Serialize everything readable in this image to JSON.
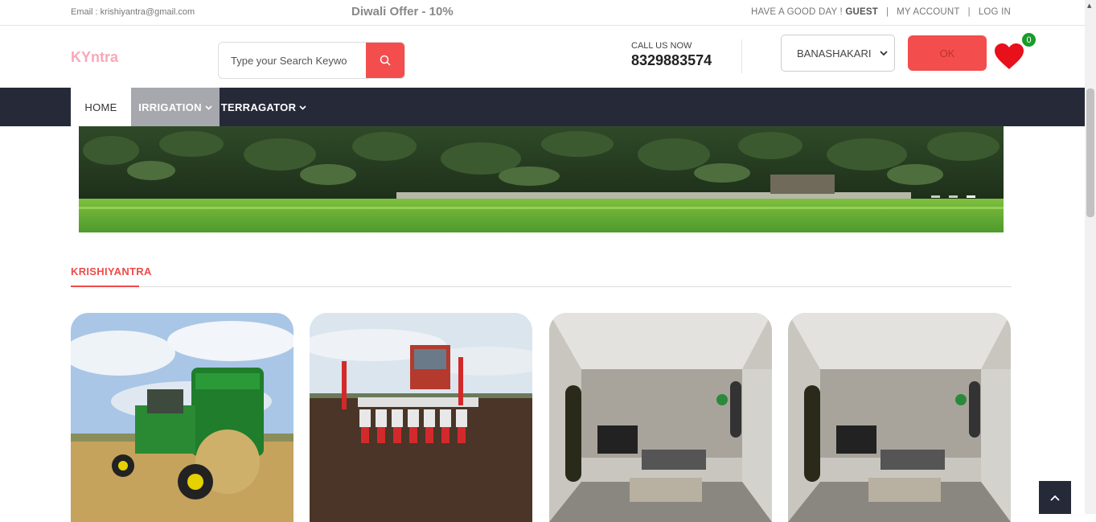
{
  "topbar": {
    "email": "Email : krishiyantra@gmail.com",
    "offer": "Diwali Offer - 10%",
    "greeting": "HAVE A GOOD DAY !",
    "user": "GUEST",
    "my_account": "MY ACCOUNT",
    "login": "LOG IN",
    "separator": "|"
  },
  "header": {
    "logo": "KYntra",
    "search_placeholder": "Type your Search Keywo",
    "call_label": "CALL US NOW",
    "phone": "8329883574",
    "location_selected": "BANASHAKARI",
    "ok_label": "OK",
    "wishlist_count": "0"
  },
  "nav": {
    "items": [
      {
        "label": "HOME"
      },
      {
        "label": "IRRIGATION"
      },
      {
        "label": "TERRAGATOR"
      }
    ]
  },
  "section": {
    "title": "KRISHIYANTRA"
  },
  "colors": {
    "accent": "#f44d4d",
    "nav_bg": "#262a38",
    "logo": "#f8a8b8",
    "badge": "#1a9b2a"
  }
}
